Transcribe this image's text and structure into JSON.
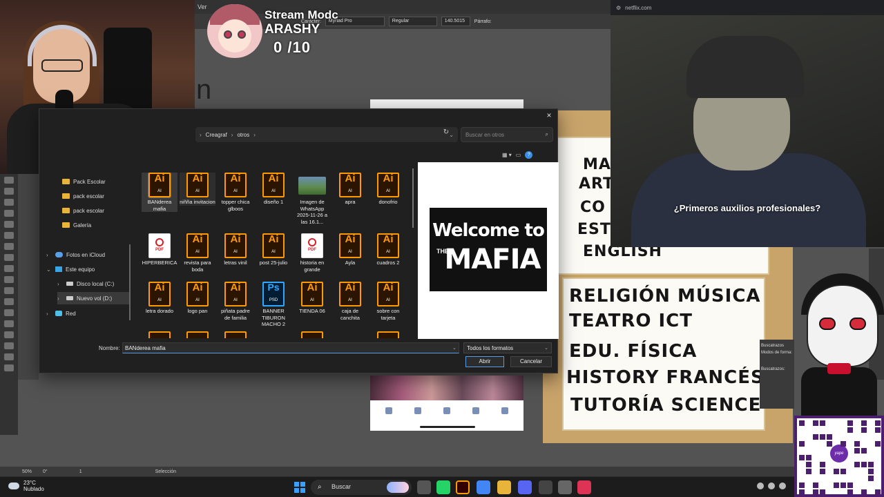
{
  "illustrator": {
    "menu": "Ver",
    "control": {
      "caracteres": "Carácter:",
      "font": "Myriad Pro",
      "style": "Regular",
      "size": "140.5015",
      "parrafo": "Párrafo:"
    },
    "status": {
      "zoom": "50%",
      "rotation": "0°",
      "artboard": "1",
      "tool": "Selección"
    },
    "canvas_letter": "n",
    "panel": {
      "title": "Buscatrazos",
      "modes": "Modos de forma:",
      "paths": "Buscatrazos:"
    }
  },
  "stream": {
    "title": "Stream Modc",
    "user": "ARASHY",
    "counter": "0 /10"
  },
  "netflix": {
    "url": "netflix.com",
    "subtitle": "¿Primeros auxilios profesionales?"
  },
  "subjects": {
    "left": [
      "MA",
      "ART",
      "CO",
      "ESTU",
      "ENGLISH"
    ],
    "right": [
      "RELIGIÓN MÚSICA",
      "TEATRO ICT",
      "EDU. FÍSICA",
      "HISTORY FRANCÉS",
      "TUTORÍA SCIENCE"
    ]
  },
  "dialog": {
    "close": "×",
    "path": [
      "Creagraf",
      "otros"
    ],
    "search_placeholder": "Buscar en otros",
    "nav": [
      {
        "label": "Pack Escolar",
        "icon": "folder-icon"
      },
      {
        "label": "pack escolar",
        "icon": "folder-icon"
      },
      {
        "label": "pack escolar",
        "icon": "folder-icon"
      },
      {
        "label": "Galería",
        "icon": "folder-icon"
      },
      {
        "label": "Fotos en iCloud",
        "icon": "cloud-icon"
      },
      {
        "label": "Este equipo",
        "icon": "pc-icon"
      },
      {
        "label": "Disco local (C:)",
        "icon": "drive-icon"
      },
      {
        "label": "Nuevo vol (D:)",
        "icon": "drive-icon"
      },
      {
        "label": "Red",
        "icon": "network-icon"
      }
    ],
    "files": [
      {
        "name": "BANderea mafia",
        "type": "ai",
        "selected": true
      },
      {
        "name": "niñña invitacion",
        "type": "ai"
      },
      {
        "name": "topper chica glboos",
        "type": "ai"
      },
      {
        "name": "diseño 1",
        "type": "ai"
      },
      {
        "name": "Imagen de WhatsApp 2025-11-26 a las 16.1...",
        "type": "img"
      },
      {
        "name": "apra",
        "type": "ai"
      },
      {
        "name": "donofrio",
        "type": "ai"
      },
      {
        "name": "HIPERBERICA",
        "type": "pdf"
      },
      {
        "name": "revista para boda",
        "type": "ai"
      },
      {
        "name": "letras vinil",
        "type": "ai"
      },
      {
        "name": "post 25-julio",
        "type": "ai"
      },
      {
        "name": "historia en grande",
        "type": "pdf"
      },
      {
        "name": "Ayla",
        "type": "ai"
      },
      {
        "name": "cuadros 2",
        "type": "ai"
      },
      {
        "name": "letra dorado",
        "type": "ai"
      },
      {
        "name": "logo pan",
        "type": "ai"
      },
      {
        "name": "piñata padre de familia",
        "type": "ai"
      },
      {
        "name": "BANNER TIBURON MACHO 2",
        "type": "psd"
      },
      {
        "name": "TIENDA 06",
        "type": "ai"
      },
      {
        "name": "caja de canchita",
        "type": "ai"
      },
      {
        "name": "sobre con tarjeta",
        "type": "ai"
      }
    ],
    "icon_labels": {
      "ai": "Ai",
      "ai_sub": "AI",
      "pdf": "PDF",
      "psd": "Ps",
      "psd_sub": "PSD"
    },
    "preview": {
      "line1": "Welcome to",
      "the": "THE",
      "line2": "MAFIA"
    },
    "name_label": "Nombre:",
    "name_value": "BANderea  mafia",
    "filter": "Todos los formatos",
    "open": "Abrir",
    "cancel": "Cancelar"
  },
  "taskbar": {
    "temperature": "23°C",
    "weather": "Nublado",
    "search": "Buscar"
  },
  "qr": {
    "badge": "yape"
  }
}
